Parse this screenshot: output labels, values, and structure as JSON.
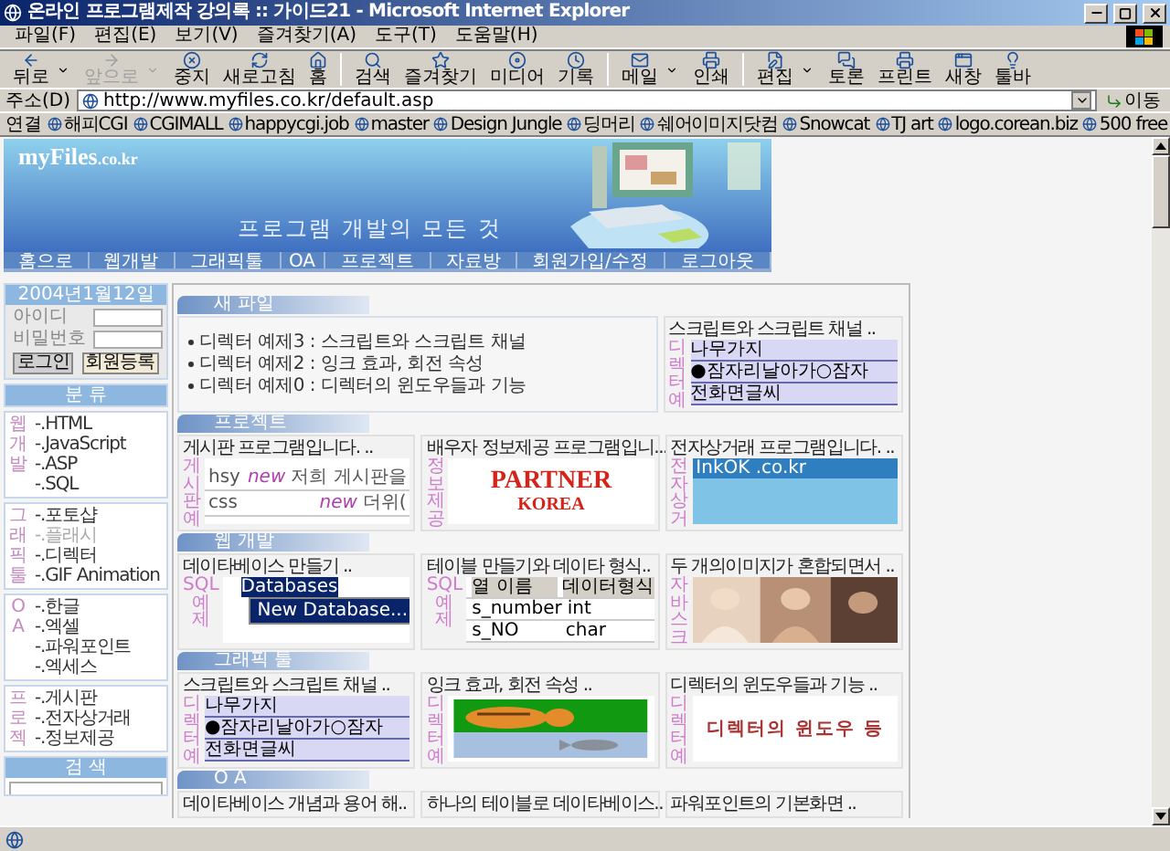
{
  "window": {
    "title": "온라인 프로그램제작 강의록 :: 가이드21 - Microsoft Internet Explorer"
  },
  "menu": [
    "파일(F)",
    "편집(E)",
    "보기(V)",
    "즐겨찾기(A)",
    "도구(T)",
    "도움말(H)"
  ],
  "toolbar": [
    {
      "kind": "back",
      "label": "뒤로",
      "disabled": false,
      "dropdown": true
    },
    {
      "kind": "forward",
      "label": "앞으로",
      "disabled": true,
      "dropdown": true
    },
    {
      "kind": "stop",
      "label": "중지",
      "disabled": false,
      "dropdown": false
    },
    {
      "kind": "refresh",
      "label": "새로고침",
      "disabled": false,
      "dropdown": false
    },
    {
      "kind": "home",
      "label": "홈",
      "disabled": false,
      "dropdown": false
    },
    {
      "kind": "search",
      "label": "검색",
      "disabled": false,
      "dropdown": false
    },
    {
      "kind": "favorites",
      "label": "즐겨찾기",
      "disabled": false,
      "dropdown": false
    },
    {
      "kind": "media",
      "label": "미디어",
      "disabled": false,
      "dropdown": false
    },
    {
      "kind": "history",
      "label": "기록",
      "disabled": false,
      "dropdown": false
    },
    {
      "kind": "mail",
      "label": "메일",
      "disabled": false,
      "dropdown": true
    },
    {
      "kind": "print",
      "label": "인쇄",
      "disabled": false,
      "dropdown": false
    },
    {
      "kind": "edit",
      "label": "편집",
      "disabled": false,
      "dropdown": true
    },
    {
      "kind": "discuss",
      "label": "토론",
      "disabled": false,
      "dropdown": false
    },
    {
      "kind": "printer",
      "label": "프린트",
      "disabled": false,
      "dropdown": false
    },
    {
      "kind": "window",
      "label": "새창",
      "disabled": false,
      "dropdown": false
    },
    {
      "kind": "bulb",
      "label": "툴바",
      "disabled": false,
      "dropdown": false
    }
  ],
  "address": {
    "label": "주소(D)",
    "value": "http://www.myfiles.co.kr/default.asp",
    "go": "이동"
  },
  "links": {
    "label": "연결",
    "items": [
      "해피CGI",
      "CGIMALL",
      "happycgi.job",
      "master",
      "Design Jungle",
      "딩머리",
      "쉐어이미지닷컴",
      "Snowcat",
      "TJ art",
      "logo.corean.biz",
      "500 free"
    ]
  },
  "site": {
    "logo": "myFiles",
    "logo_suffix": ".co.kr",
    "slogan": "프로그램 개발의 모든 것",
    "nav": [
      "홈으로",
      "웹개발",
      "그래픽툴",
      "OA",
      "프로젝트",
      "자료방",
      "회원가입/수정",
      "로그아웃"
    ]
  },
  "login": {
    "date": "2004년1월12일",
    "id_label": "아이디",
    "pw_label": "비밀번호",
    "buttons": [
      "로그인",
      "회원등록"
    ]
  },
  "categories": {
    "title": "분 류",
    "groups": [
      {
        "side": [
          "웹",
          "개",
          "발"
        ],
        "items": [
          {
            "label": "-.HTML",
            "disabled": false
          },
          {
            "label": "-.JavaScript",
            "disabled": false
          },
          {
            "label": "-.ASP",
            "disabled": false
          },
          {
            "label": "-.SQL",
            "disabled": false
          }
        ]
      },
      {
        "side": [
          "그",
          "래",
          "픽",
          "툴"
        ],
        "items": [
          {
            "label": "-.포토샵",
            "disabled": false
          },
          {
            "label": "-.플래시",
            "disabled": true
          },
          {
            "label": "-.디렉터",
            "disabled": false
          },
          {
            "label": "-.GIF Animation",
            "disabled": false
          }
        ]
      },
      {
        "side": [
          "O",
          "A"
        ],
        "items": [
          {
            "label": "-.한글",
            "disabled": false
          },
          {
            "label": "-.엑셀",
            "disabled": false
          },
          {
            "label": "-.파워포인트",
            "disabled": false
          },
          {
            "label": "-.엑세스",
            "disabled": false
          }
        ]
      },
      {
        "side": [
          "프",
          "로",
          "젝"
        ],
        "items": [
          {
            "label": "-.게시판",
            "disabled": false
          },
          {
            "label": "-.전자상거래",
            "disabled": false
          },
          {
            "label": "-.정보제공",
            "disabled": false
          }
        ]
      }
    ]
  },
  "search": {
    "title": "검 색"
  },
  "sections": [
    {
      "title": "새 파일",
      "news": [
        "디렉터 예제3 : 스크립트와 스크립트 채널",
        "디렉터 예제2 : 잉크 효과, 회전 속성",
        "디렉터 예제0 : 디렉터의 윈도우들과 기능"
      ],
      "cards": [
        {
          "title": "스크립트와 스크립트 채널 ..",
          "side": [
            "디",
            "렉",
            "터",
            "예"
          ],
          "thumb": {
            "kind": "script",
            "texts": [
              "나무가지",
              "●잠자리날아가○잠자",
              "전화면글씨"
            ]
          }
        }
      ]
    },
    {
      "title": "프로젝트",
      "cards": [
        {
          "title": "게시판 프로그램입니다. ..",
          "side": [
            "게",
            "시",
            "판",
            "예"
          ],
          "thumb": {
            "kind": "board",
            "rows": [
              {
                "name": "hsy",
                "badge": "new",
                "text": "저희 게시판을"
              },
              {
                "name": "css",
                "badge": "new",
                "text": "더위("
              }
            ]
          }
        },
        {
          "title": "배우자 정보제공 프로그램입니...",
          "side": [
            "정",
            "보",
            "제",
            "공"
          ],
          "thumb": {
            "kind": "logo",
            "texts": [
              "PARTNER",
              "KOREA"
            ]
          }
        },
        {
          "title": "전자상거래 프로그램입니다. ..",
          "side": [
            "전",
            "자",
            "상",
            "거"
          ],
          "thumb": {
            "kind": "shop",
            "texts": [
              "InkOK .co.kr"
            ]
          }
        }
      ]
    },
    {
      "title": "웹 개발",
      "cards": [
        {
          "title": "데이타베이스 만들기 ..",
          "side": [
            "SQL",
            "예",
            "제"
          ],
          "thumb": {
            "kind": "db",
            "texts": [
              "Databases",
              "New Database..."
            ]
          }
        },
        {
          "title": "테이블 만들기와 데이타 형식..",
          "side": [
            "SQL",
            "예",
            "제"
          ],
          "thumb": {
            "kind": "table",
            "header": [
              "열 이름",
              "데이터형식"
            ],
            "rows": [
              [
                "s_number",
                "int"
              ],
              [
                "s_NO",
                "char"
              ]
            ]
          }
        },
        {
          "title": "두 개의이미지가 혼합되면서 ..",
          "side": [
            "자",
            "바",
            "스",
            "크"
          ],
          "thumb": {
            "kind": "picture"
          }
        }
      ]
    },
    {
      "title": "그래픽 툴",
      "cards": [
        {
          "title": "스크립트와 스크립트 채널 ..",
          "side": [
            "디",
            "렉",
            "터",
            "예"
          ],
          "thumb": {
            "kind": "script",
            "texts": [
              "나무가지",
              "●잠자리날아가○잠자",
              "전화면글씨"
            ]
          }
        },
        {
          "title": "잉크 효과, 회전 속성 ..",
          "side": [
            "디",
            "렉",
            "터",
            "예"
          ],
          "thumb": {
            "kind": "picture"
          }
        },
        {
          "title": "디렉터의 윈도우들과 기능 ..",
          "side": [
            "디",
            "렉",
            "터",
            "예"
          ],
          "thumb": {
            "kind": "banner",
            "texts": [
              "디렉터의 윈도우 등"
            ]
          }
        }
      ]
    },
    {
      "title": "O A",
      "cards": [
        {
          "title": "데이타베이스 개념과 용어 해.."
        },
        {
          "title": "하나의 테이블로 데이타베이스.."
        },
        {
          "title": "파워포인트의 기본화면 .."
        }
      ]
    }
  ]
}
